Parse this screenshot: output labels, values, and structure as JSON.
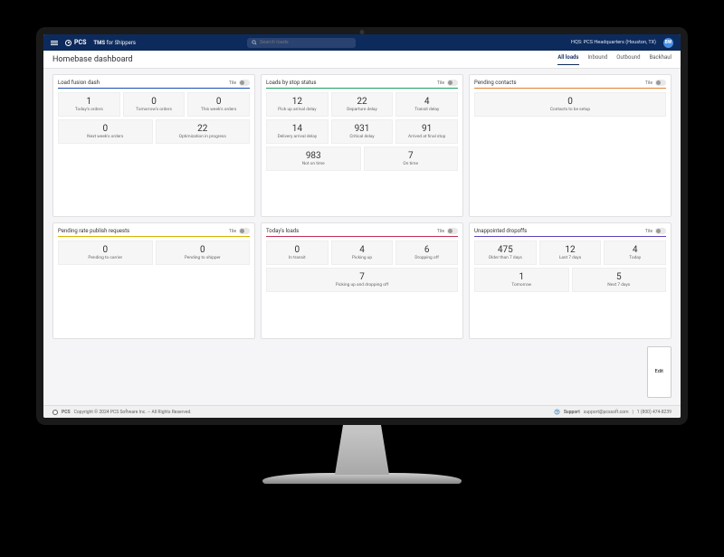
{
  "header": {
    "brand": "PCS",
    "product_name": "TMS",
    "product_suffix": "for Shippers",
    "search_placeholder": "Search loads",
    "hq_label": "HQS: PCS Headquarters (Houston, TX)",
    "avatar_initials": "BW"
  },
  "page": {
    "title": "Homebase dashboard"
  },
  "tabs": [
    {
      "label": "All loads",
      "active": true
    },
    {
      "label": "Inbound",
      "active": false
    },
    {
      "label": "Outbound",
      "active": false
    },
    {
      "label": "Backhaul",
      "active": false
    }
  ],
  "tile_label": "Tile",
  "edit_label": "Edit",
  "panels": {
    "load_fusion": {
      "title": "Load fusion dash",
      "metrics": [
        {
          "value": "1",
          "label": "Today's orders"
        },
        {
          "value": "0",
          "label": "Tomorrow's orders"
        },
        {
          "value": "0",
          "label": "This week's orders"
        },
        {
          "value": "0",
          "label": "Next week's orders"
        },
        {
          "value": "22",
          "label": "Optimization in progress"
        }
      ]
    },
    "loads_by_stop": {
      "title": "Loads by stop status",
      "metrics": [
        {
          "value": "12",
          "label": "Pick up arrival delay"
        },
        {
          "value": "22",
          "label": "Departure delay"
        },
        {
          "value": "4",
          "label": "Transit delay"
        },
        {
          "value": "14",
          "label": "Delivery arrival delay"
        },
        {
          "value": "931",
          "label": "Critical delay"
        },
        {
          "value": "91",
          "label": "Arrived at final stop"
        },
        {
          "value": "983",
          "label": "Not on time"
        },
        {
          "value": "7",
          "label": "On time"
        }
      ]
    },
    "pending_contacts": {
      "title": "Pending contacts",
      "metrics": [
        {
          "value": "0",
          "label": "Contacts to be setup"
        }
      ]
    },
    "pending_rate": {
      "title": "Pending rate publish requests",
      "metrics": [
        {
          "value": "0",
          "label": "Pending to carrier"
        },
        {
          "value": "0",
          "label": "Pending to shipper"
        }
      ]
    },
    "todays_loads": {
      "title": "Today's loads",
      "metrics": [
        {
          "value": "0",
          "label": "In transit"
        },
        {
          "value": "4",
          "label": "Picking up"
        },
        {
          "value": "6",
          "label": "Dropping off"
        },
        {
          "value": "7",
          "label": "Picking up and dropping off"
        }
      ]
    },
    "unappointed": {
      "title": "Unappointed dropoffs",
      "metrics": [
        {
          "value": "475",
          "label": "Older than 7 days"
        },
        {
          "value": "12",
          "label": "Last 7 days"
        },
        {
          "value": "4",
          "label": "Today"
        },
        {
          "value": "1",
          "label": "Tomorrow"
        },
        {
          "value": "5",
          "label": "Next 7 days"
        }
      ]
    }
  },
  "footer": {
    "brand": "PCS",
    "copyright": "Copyright © 2024 PCS Software Inc. – All Rights Reserved.",
    "support_label": "Support",
    "support_email": "support@pcssoft.com",
    "support_phone": "1 (800) 474-8239"
  }
}
